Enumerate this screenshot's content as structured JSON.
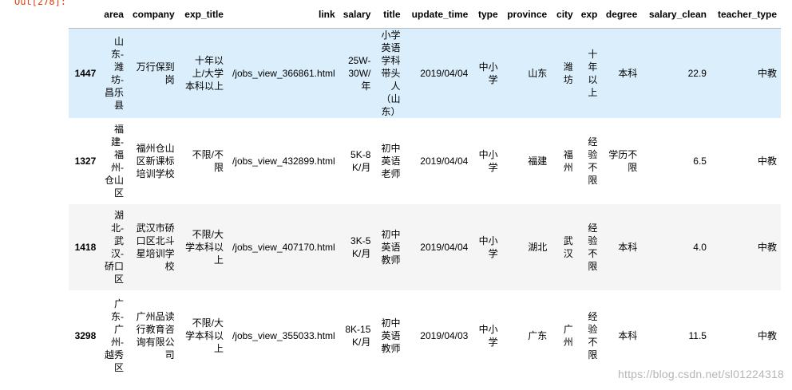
{
  "prompt": "Out[278]:",
  "columns": [
    "area",
    "company",
    "exp_title",
    "link",
    "salary",
    "title",
    "update_time",
    "type",
    "province",
    "city",
    "exp",
    "degree",
    "salary_clean",
    "teacher_type"
  ],
  "rows": [
    {
      "index": "1447",
      "area": "山东-潍坊-昌乐县",
      "company": "万行保到岗",
      "exp_title": "十年以上/大学本科以上",
      "link": "/jobs_view_366861.html",
      "salary": "25W-30W/年",
      "title": "小学英语学科带头人（山东）",
      "update_time": "2019/04/04",
      "type": "中小学",
      "province": "山东",
      "city": "潍坊",
      "exp": "十年以上",
      "degree": "本科",
      "salary_clean": "22.9",
      "teacher_type": "中教"
    },
    {
      "index": "1327",
      "area": "福建-福州-仓山区",
      "company": "福州仓山区新课标培训学校",
      "exp_title": "不限/不限",
      "link": "/jobs_view_432899.html",
      "salary": "5K-8K/月",
      "title": "初中英语老师",
      "update_time": "2019/04/04",
      "type": "中小学",
      "province": "福建",
      "city": "福州",
      "exp": "经验不限",
      "degree": "学历不限",
      "salary_clean": "6.5",
      "teacher_type": "中教"
    },
    {
      "index": "1418",
      "area": "湖北-武汉-硚口区",
      "company": "武汉市硚口区北斗星培训学校",
      "exp_title": "不限/大学本科以上",
      "link": "/jobs_view_407170.html",
      "salary": "3K-5K/月",
      "title": "初中英语教师",
      "update_time": "2019/04/04",
      "type": "中小学",
      "province": "湖北",
      "city": "武汉",
      "exp": "经验不限",
      "degree": "本科",
      "salary_clean": "4.0",
      "teacher_type": "中教"
    },
    {
      "index": "3298",
      "area": "广东-广州-越秀区",
      "company": "广州品读行教育咨询有限公司",
      "exp_title": "不限/大学本科以上",
      "link": "/jobs_view_355033.html",
      "salary": "8K-15K/月",
      "title": "初中英语教师",
      "update_time": "2019/04/03",
      "type": "中小学",
      "province": "广东",
      "city": "广州",
      "exp": "经验不限",
      "degree": "本科",
      "salary_clean": "11.5",
      "teacher_type": "中教"
    }
  ],
  "watermark": "https://blog.csdn.net/sl01224318"
}
